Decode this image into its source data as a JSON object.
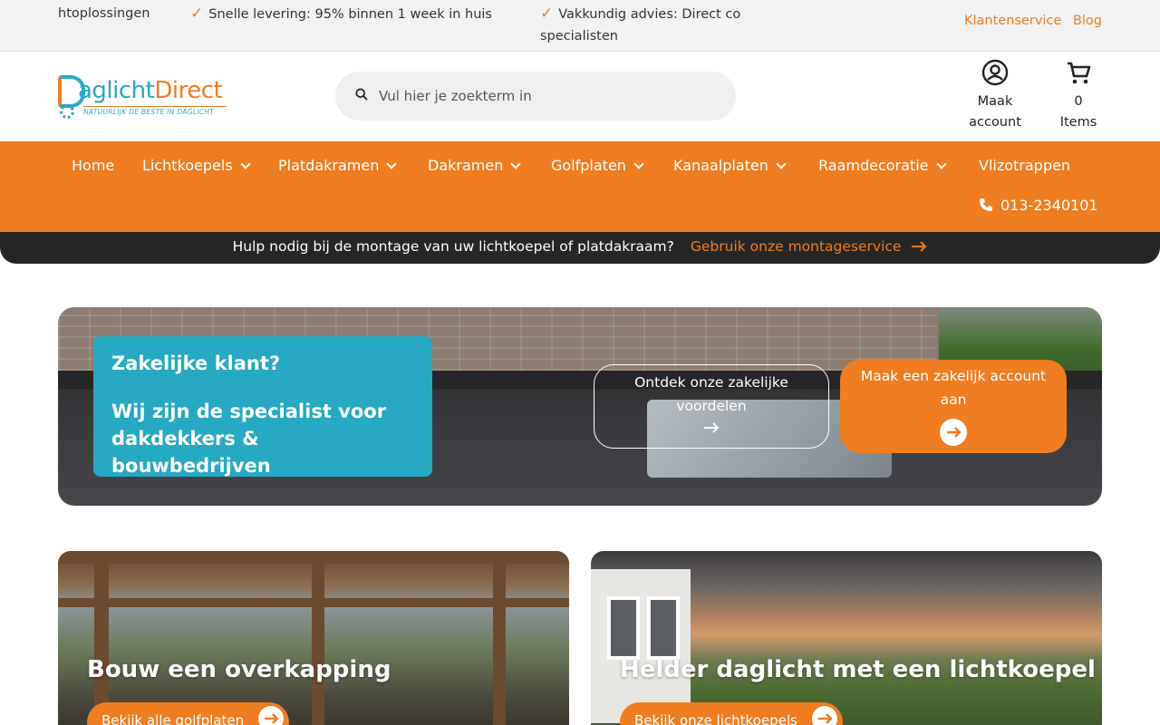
{
  "usps": {
    "item1": "htoplossingen",
    "item2": "Snelle levering: 95% binnen 1 week in huis",
    "item3_line1": "Vakkundig advies: Direct co",
    "item3_line2": "specialisten"
  },
  "toplinks": {
    "service": "Klantenservice",
    "blog": "Blog"
  },
  "logo": {
    "brand_part1": "aglicht",
    "brand_part2": "Direct",
    "tagline": "NATUURLIJK DE BESTE IN DAGLICHT"
  },
  "search": {
    "placeholder": "Vul hier je zoekterm in"
  },
  "account": {
    "line1": "Maak",
    "line2": "account"
  },
  "cart": {
    "count": "0",
    "label": "Items"
  },
  "nav": {
    "items": [
      {
        "label": "Home",
        "has_dropdown": false
      },
      {
        "label": "Lichtkoepels",
        "has_dropdown": true
      },
      {
        "label": "Platdakramen",
        "has_dropdown": true
      },
      {
        "label": "Dakramen",
        "has_dropdown": true
      },
      {
        "label": "Golfplaten",
        "has_dropdown": true
      },
      {
        "label": "Kanaalplaten",
        "has_dropdown": true
      },
      {
        "label": "Raamdecoratie",
        "has_dropdown": true
      },
      {
        "label": "Vlizotrappen",
        "has_dropdown": false
      }
    ],
    "phone": "013-2340101"
  },
  "montage": {
    "text": "Hulp nodig bij de montage van uw lichtkoepel of platdakraam?",
    "link": "Gebruik onze montageservice"
  },
  "hero": {
    "heading": "Zakelijke klant?",
    "subheading": "Wij zijn de specialist voor dakdekkers & bouwbedrijven",
    "button_ghost": "Ontdek onze zakelijke voordelen",
    "button_solid": "Maak een zakelijk account aan"
  },
  "cards": [
    {
      "title": "Bouw een overkapping",
      "button": "Bekijk alle golfplaten"
    },
    {
      "title": "Helder daglicht met een lichtkoepel",
      "button": "Bekijk onze lichtkoepels"
    }
  ],
  "colors": {
    "accent": "#ef7d22",
    "brand_blue": "#27a8c3",
    "dark_bar": "#262626"
  }
}
